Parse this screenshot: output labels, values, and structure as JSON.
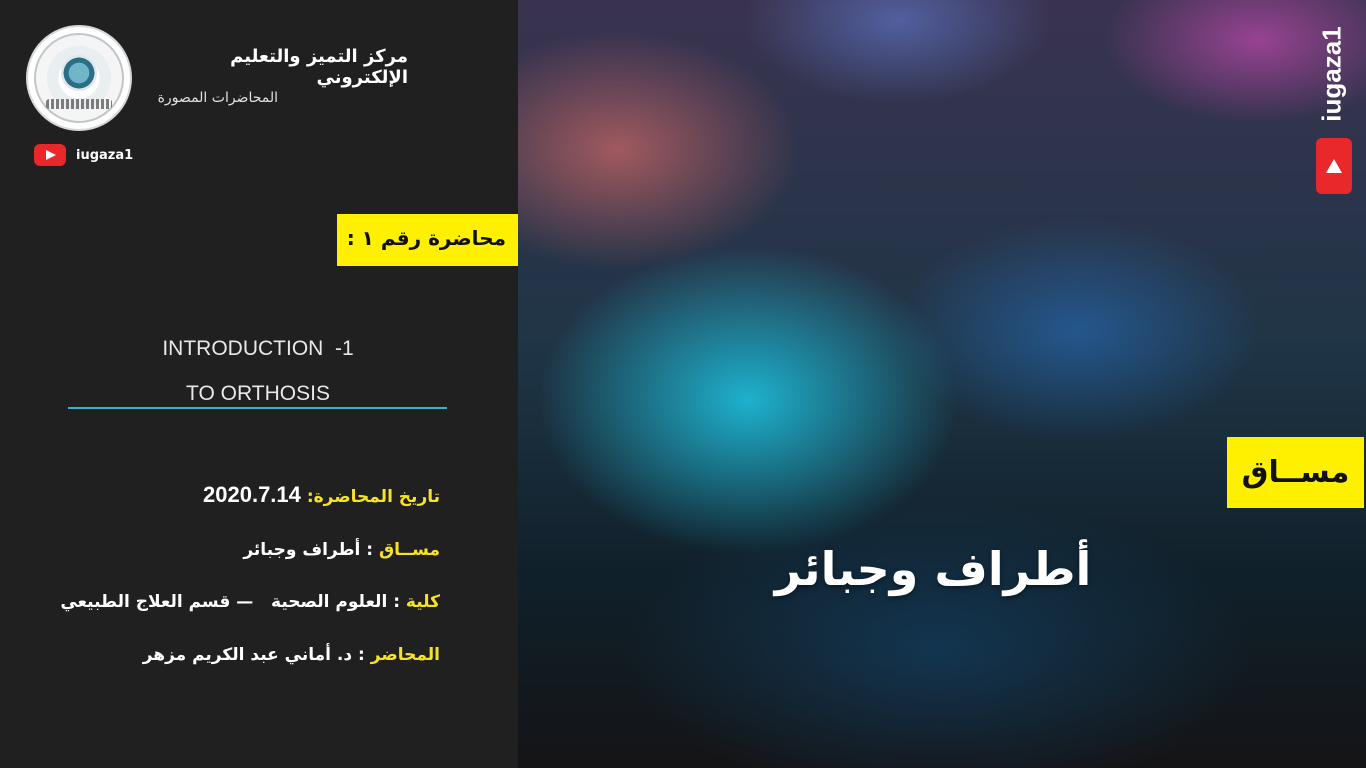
{
  "header": {
    "org_title": "مركز التميز والتعليم الإلكتروني",
    "org_subtitle": "المحاضرات المصورة",
    "channel": "iugaza1",
    "logo_icon": "university-seal-icon",
    "youtube_icon": "youtube-icon"
  },
  "lecture": {
    "badge": "محاضرة رقم ١ :",
    "title_line1": "INTRODUCTION  -1",
    "title_line2": "TO ORTHOSIS"
  },
  "details": {
    "date_label": "تاريخ المحاضرة:",
    "date_value": "2020.7.14",
    "course_label": "مســاق",
    "course_value": "أطراف وجبائر",
    "faculty_label": "كلية",
    "faculty_value": "العلوم الصحية   — قسم العلاج الطبيعي",
    "lecturer_label": "المحاضر",
    "lecturer_value": "د. أماني عبد الكريم مزهر"
  },
  "right_panel": {
    "brand_vertical": "iugaza1",
    "course_tag": "مســاق",
    "course_name": "أطراف وجبائر"
  },
  "colors": {
    "highlight_yellow": "#fff000",
    "label_yellow": "#f6e326",
    "divider_teal": "#39b3c4",
    "youtube_red": "#e8282b",
    "panel_dark": "#202020"
  }
}
